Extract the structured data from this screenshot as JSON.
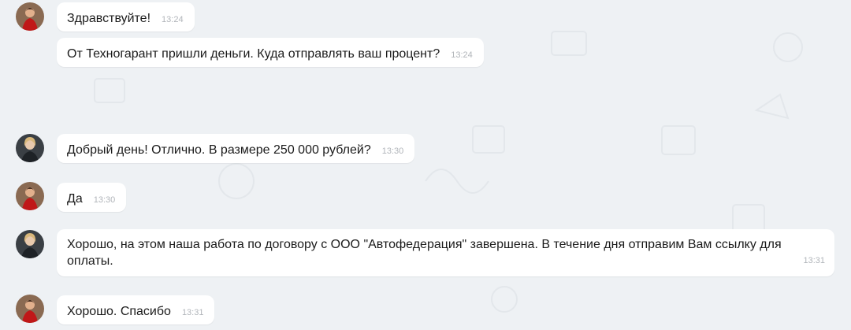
{
  "messages": [
    {
      "sender": "partner",
      "text": "Здравствуйте!",
      "time": "13:24"
    },
    {
      "sender": "partner",
      "text": "От Техногарант пришли деньги. Куда отправлять ваш процент?",
      "time": "13:24"
    },
    {
      "sender": "client",
      "text": "Добрый день! Отлично. В размере 250 000 рублей?",
      "time": "13:30"
    },
    {
      "sender": "partner",
      "text": "Да",
      "time": "13:30"
    },
    {
      "sender": "client",
      "text": "Хорошо, на этом наша работа по договору с ООО \"Автофедерация\" завершена. В течение дня отправим Вам ссылку для оплаты.",
      "time": "13:31"
    },
    {
      "sender": "partner",
      "text": "Хорошо. Спасибо",
      "time": "13:31"
    }
  ],
  "colors": {
    "background": "#eef1f4",
    "bubble": "#ffffff",
    "text": "#1b1b1b",
    "timestamp": "#b1b5ba",
    "avatar_partner_dress": "#c01818",
    "avatar_client_bg": "#3a3f44"
  }
}
